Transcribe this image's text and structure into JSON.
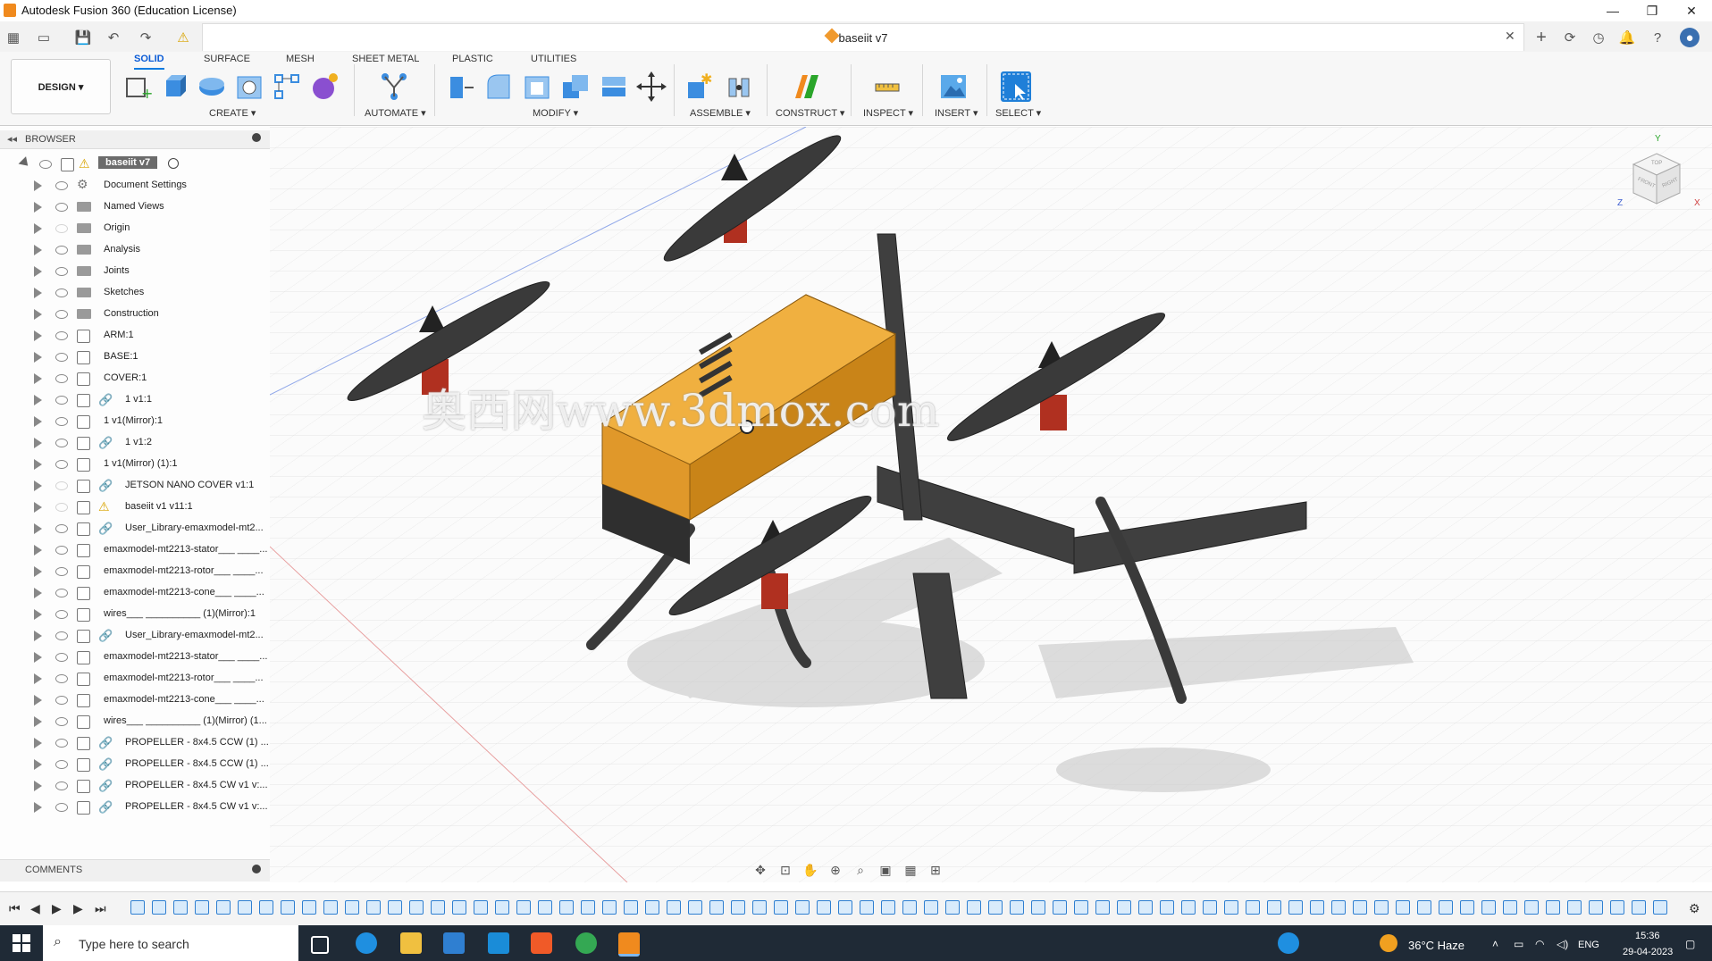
{
  "window": {
    "title": "Autodesk Fusion 360 (Education License)",
    "minimize": "—",
    "restore": "❐",
    "close": "✕"
  },
  "document": {
    "tab_title": "baseiit v7",
    "close_glyph": "✕"
  },
  "ribbon": {
    "tabs": [
      "SOLID",
      "SURFACE",
      "MESH",
      "SHEET METAL",
      "PLASTIC",
      "UTILITIES"
    ],
    "active_tab": "SOLID",
    "workspace_button": "DESIGN ▾",
    "groups": [
      "CREATE ▾",
      "AUTOMATE ▾",
      "MODIFY ▾",
      "ASSEMBLE ▾",
      "CONSTRUCT ▾",
      "INSPECT ▾",
      "INSERT ▾",
      "SELECT ▾"
    ]
  },
  "browser": {
    "title": "BROWSER",
    "root_label": "baseiit v7",
    "items": [
      {
        "label": "Document Settings",
        "kind": "settings",
        "visible": true
      },
      {
        "label": "Named Views",
        "kind": "folder",
        "visible": true
      },
      {
        "label": "Origin",
        "kind": "folder",
        "visible": false
      },
      {
        "label": "Analysis",
        "kind": "folder",
        "visible": true
      },
      {
        "label": "Joints",
        "kind": "folder",
        "visible": true
      },
      {
        "label": "Sketches",
        "kind": "folder",
        "visible": true
      },
      {
        "label": "Construction",
        "kind": "folder",
        "visible": true
      },
      {
        "label": "ARM:1",
        "kind": "component",
        "visible": true
      },
      {
        "label": "BASE:1",
        "kind": "component",
        "visible": true
      },
      {
        "label": "COVER:1",
        "kind": "component",
        "visible": true
      },
      {
        "label": "1 v1:1",
        "kind": "link",
        "visible": true
      },
      {
        "label": "1 v1(Mirror):1",
        "kind": "component",
        "visible": true
      },
      {
        "label": "1 v1:2",
        "kind": "link",
        "visible": true
      },
      {
        "label": "1 v1(Mirror) (1):1",
        "kind": "component",
        "visible": true
      },
      {
        "label": "JETSON NANO COVER v1:1",
        "kind": "link",
        "visible": false
      },
      {
        "label": "baseiit v1 v11:1",
        "kind": "warning",
        "visible": false
      },
      {
        "label": "User_Library-emaxmodel-mt2...",
        "kind": "link",
        "visible": true
      },
      {
        "label": "emaxmodel-mt2213-stator___ ____...",
        "kind": "component",
        "visible": true
      },
      {
        "label": "emaxmodel-mt2213-rotor___ ____...",
        "kind": "component",
        "visible": true
      },
      {
        "label": "emaxmodel-mt2213-cone___ ____...",
        "kind": "component",
        "visible": true
      },
      {
        "label": "wires___ __________ (1)(Mirror):1",
        "kind": "component",
        "visible": true
      },
      {
        "label": "User_Library-emaxmodel-mt2...",
        "kind": "link",
        "visible": true
      },
      {
        "label": "emaxmodel-mt2213-stator___ ____...",
        "kind": "component",
        "visible": true
      },
      {
        "label": "emaxmodel-mt2213-rotor___ ____...",
        "kind": "component",
        "visible": true
      },
      {
        "label": "emaxmodel-mt2213-cone___ ____...",
        "kind": "component",
        "visible": true
      },
      {
        "label": "wires___ __________ (1)(Mirror) (1...",
        "kind": "component",
        "visible": true
      },
      {
        "label": "PROPELLER - 8x4.5 CCW (1) ...",
        "kind": "link",
        "visible": true
      },
      {
        "label": "PROPELLER - 8x4.5 CCW (1) ...",
        "kind": "link",
        "visible": true
      },
      {
        "label": "PROPELLER - 8x4.5 CW v1 v:...",
        "kind": "link",
        "visible": true
      },
      {
        "label": "PROPELLER - 8x4.5 CW v1 v:...",
        "kind": "link",
        "visible": true
      }
    ]
  },
  "comments": {
    "title": "COMMENTS"
  },
  "viewport": {
    "watermark": "奥西网www.3dmox.com",
    "viewcube": {
      "top": "TOP",
      "front": "FRONT",
      "right": "RIGHT",
      "axis_x": "X",
      "axis_y": "Y",
      "axis_z": "Z"
    },
    "model_color": "#e8a62a"
  },
  "taskbar": {
    "search_placeholder": "Type here to search",
    "weather": "36°C Haze",
    "language": "ENG",
    "time": "15:36",
    "date": "29-04-2023"
  }
}
